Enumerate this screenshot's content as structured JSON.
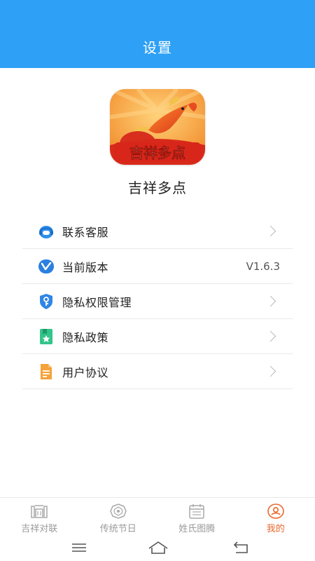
{
  "header": {
    "title": "设置"
  },
  "app": {
    "logo_text": "吉祥多点",
    "name": "吉祥多点"
  },
  "menu": {
    "items": [
      {
        "label": "联系客服",
        "icon": "headset-icon",
        "action": "chevron"
      },
      {
        "label": "当前版本",
        "icon": "version-icon",
        "value": "V1.6.3"
      },
      {
        "label": "隐私权限管理",
        "icon": "shield-key-icon",
        "action": "chevron"
      },
      {
        "label": "隐私政策",
        "icon": "bookmark-star-icon",
        "action": "chevron"
      },
      {
        "label": "用户协议",
        "icon": "document-icon",
        "action": "chevron"
      }
    ]
  },
  "tabbar": {
    "tabs": [
      {
        "label": "吉祥对联",
        "icon": "couplet-gate-icon",
        "active": false
      },
      {
        "label": "传统节日",
        "icon": "festival-emblem-icon",
        "active": false
      },
      {
        "label": "姓氏图腾",
        "icon": "calendar-icon",
        "active": false
      },
      {
        "label": "我的",
        "icon": "profile-icon",
        "active": true
      }
    ]
  },
  "system_nav": {
    "buttons": [
      "menu-icon",
      "home-icon",
      "back-icon"
    ]
  },
  "colors": {
    "header_bg": "#2ea0f5",
    "active_tab": "#e9672a",
    "inactive_tab": "#9a9a9a"
  }
}
